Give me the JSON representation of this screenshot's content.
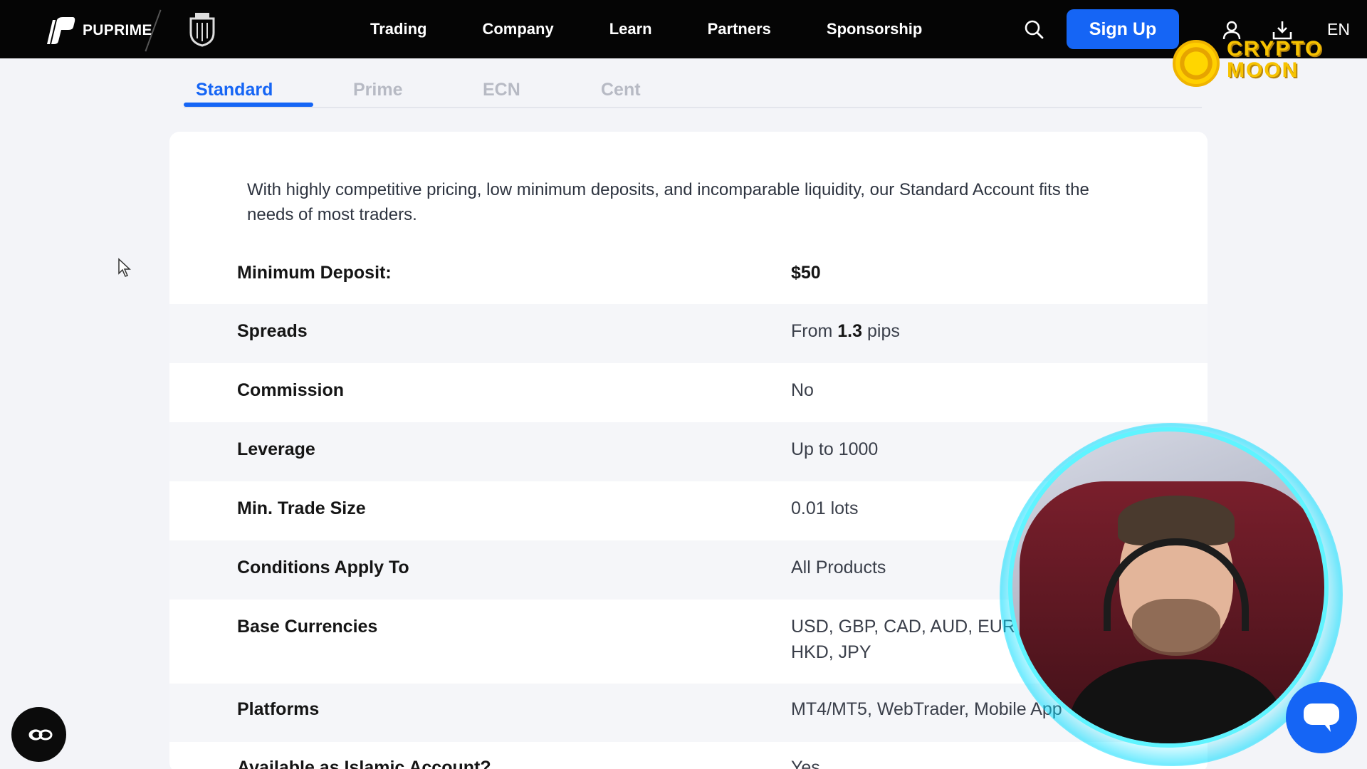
{
  "header": {
    "brand": "PUPRIME",
    "nav": [
      "Trading",
      "Company",
      "Learn",
      "Partners",
      "Sponsorship"
    ],
    "signup_label": "Sign Up",
    "language": "EN"
  },
  "watermark": {
    "line1": "CRYPTO",
    "line2": "MOON"
  },
  "tabs": [
    {
      "label": "Standard",
      "active": true
    },
    {
      "label": "Prime",
      "active": false
    },
    {
      "label": "ECN",
      "active": false
    },
    {
      "label": "Cent",
      "active": false
    }
  ],
  "account": {
    "description": "With highly competitive pricing, low minimum deposits, and incomparable liquidity, our Standard Account fits the needs of most traders.",
    "rows": [
      {
        "label": "Minimum Deposit:",
        "value": "$50"
      },
      {
        "label": "Spreads",
        "value_prefix": "From ",
        "value_bold": "1.3",
        "value_suffix": " pips"
      },
      {
        "label": "Commission",
        "value": "No"
      },
      {
        "label": "Leverage",
        "value": "Up to 1000"
      },
      {
        "label": "Min. Trade Size",
        "value": "0.01 lots"
      },
      {
        "label": "Conditions Apply To",
        "value": "All Products"
      },
      {
        "label": "Base Currencies",
        "value_line1": "USD, GBP, CAD, AUD, EUR",
        "value_line2": "HKD, JPY"
      },
      {
        "label": "Platforms",
        "value": "MT4/MT5, WebTrader, Mobile App"
      },
      {
        "label": "Available as Islamic Account?",
        "value": "Yes"
      }
    ]
  },
  "colors": {
    "accent": "#1565f5",
    "topbar": "#050505",
    "page_bg": "#f3f4f8",
    "webcam_ring": "#5ff4ff"
  },
  "icons": [
    "puprime-logo-icon",
    "crest-icon",
    "search-icon",
    "user-icon",
    "download-icon",
    "chat-icon",
    "closed-captions-icon",
    "cursor-icon"
  ]
}
